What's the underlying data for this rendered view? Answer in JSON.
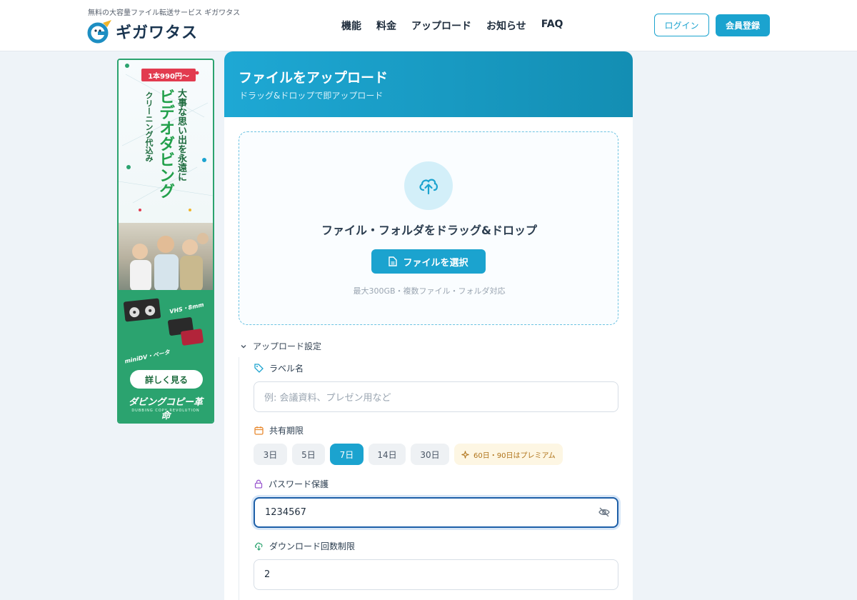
{
  "header": {
    "tagline": "無料の大容量ファイル転送サービス ギガワタス",
    "logo_text": "ギガワタス",
    "nav": [
      "機能",
      "料金",
      "アップロード",
      "お知らせ",
      "FAQ"
    ],
    "login_label": "ログイン",
    "signup_label": "会員登録"
  },
  "ad": {
    "price": "1本990円～",
    "line1": "大事な思い出を永遠に",
    "line2": "ビデオダビング",
    "line3": "クリーニング代込み",
    "media1": "VHS・8mm",
    "media2": "miniDV・ベータ",
    "cta": "詳しく見る",
    "brand": "ダビングコピー革命",
    "brand_sub": "DUBBING COPY REVOLUTION"
  },
  "upload": {
    "title": "ファイルをアップロード",
    "subtitle": "ドラッグ&ドロップで即アップロード",
    "drop_text": "ファイル・フォルダをドラッグ&ドロップ",
    "select_button": "ファイルを選択",
    "note": "最大300GB・複数ファイル・フォルダ対応"
  },
  "settings": {
    "toggle_label": "アップロード設定",
    "label_field": {
      "label": "ラベル名",
      "placeholder": "例: 会議資料、プレゼン用など"
    },
    "expiry": {
      "label": "共有期限",
      "options": [
        "3日",
        "5日",
        "7日",
        "14日",
        "30日"
      ],
      "selected": "7日",
      "premium_note": "60日・90日はプレミアム"
    },
    "password": {
      "label": "パスワード保護",
      "value": "1234567"
    },
    "download_limit": {
      "label": "ダウンロード回数制限",
      "value": "2"
    }
  },
  "colors": {
    "accent": "#1ba3cf",
    "header_gradient_start": "#1ea8d4",
    "header_gradient_end": "#138eb3",
    "ad_green": "#2ba36f"
  }
}
